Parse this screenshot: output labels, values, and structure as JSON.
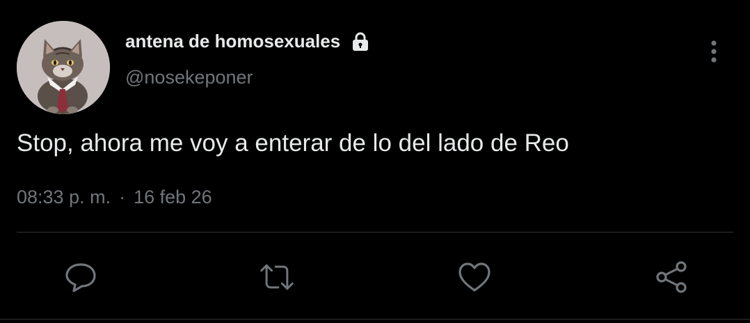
{
  "tweet": {
    "author": {
      "display_name": "antena de homosexuales",
      "handle": "@nosekeponer",
      "protected_icon": "lock-icon",
      "avatar": "cat-in-suit-avatar"
    },
    "text": "Stop, ahora me voy a enterar de lo del lado de Reo",
    "time": "08:33 p. m.",
    "separator": "·",
    "date": "16 feb 26"
  },
  "actions": [
    {
      "name": "reply",
      "icon": "speech-bubble-icon"
    },
    {
      "name": "retweet",
      "icon": "retweet-arrows-icon"
    },
    {
      "name": "like",
      "icon": "heart-icon"
    },
    {
      "name": "share",
      "icon": "share-nodes-icon"
    }
  ],
  "menu": {
    "icon": "more-vertical-icon"
  },
  "colors": {
    "background": "#000000",
    "primary_text": "#e7e9ea",
    "secondary_text": "#71767b",
    "divider": "#2f3336"
  }
}
